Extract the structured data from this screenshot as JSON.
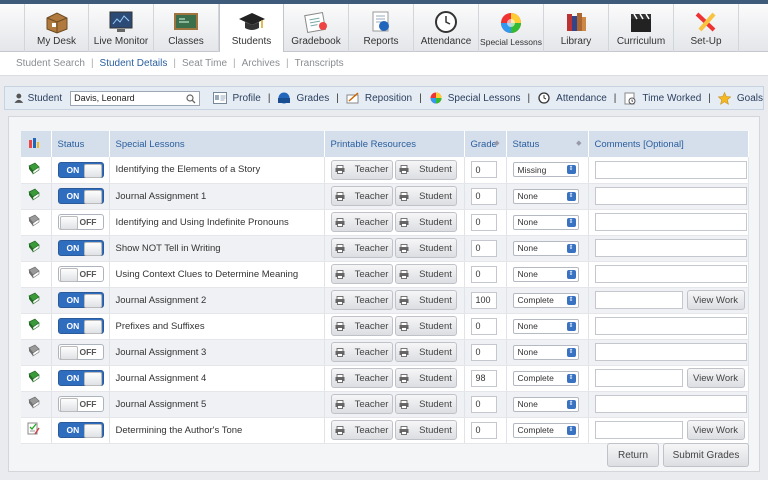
{
  "nav": {
    "items": [
      {
        "label": "My Desk",
        "icon": "box-icon"
      },
      {
        "label": "Live Monitor",
        "icon": "monitor-icon"
      },
      {
        "label": "Classes",
        "icon": "chalkboard-icon"
      },
      {
        "label": "Students",
        "icon": "graduation-cap-icon"
      },
      {
        "label": "Gradebook",
        "icon": "gradebook-icon"
      },
      {
        "label": "Reports",
        "icon": "reports-icon"
      },
      {
        "label": "Attendance",
        "icon": "clock-icon"
      },
      {
        "label": "Special Lessons",
        "icon": "color-wheel-icon"
      },
      {
        "label": "Library",
        "icon": "books-icon"
      },
      {
        "label": "Curriculum",
        "icon": "clapper-icon"
      },
      {
        "label": "Set-Up",
        "icon": "setup-icon"
      }
    ],
    "active": "Students"
  },
  "subnav": {
    "items": [
      "Student Search",
      "Student Details",
      "Seat Time",
      "Archives",
      "Transcripts"
    ],
    "active": "Student Details"
  },
  "studentbar": {
    "label": "Student",
    "student_name": "Davis, Leonard",
    "links": [
      "Profile",
      "Grades",
      "Reposition",
      "Special Lessons",
      "Attendance",
      "Time Worked",
      "Goals"
    ]
  },
  "table": {
    "headers": {
      "status": "Status",
      "lesson": "Special Lessons",
      "resources": "Printable Resources",
      "grade": "Grade",
      "status2": "Status",
      "comments": "Comments [Optional]"
    },
    "teacher_label": "Teacher",
    "student_label": "Student",
    "view_work_label": "View Work",
    "rows": [
      {
        "toggle": "ON",
        "lesson": "Identifying the Elements of a Story",
        "grade": "0",
        "status": "Missing",
        "view_work": false,
        "icon": "green-book-icon"
      },
      {
        "toggle": "ON",
        "lesson": "Journal Assignment 1",
        "grade": "0",
        "status": "None",
        "view_work": false,
        "icon": "green-book-icon"
      },
      {
        "toggle": "OFF",
        "lesson": "Identifying and Using Indefinite Pronouns",
        "grade": "0",
        "status": "None",
        "view_work": false,
        "icon": "grey-book-icon"
      },
      {
        "toggle": "ON",
        "lesson": "Show NOT Tell in Writing",
        "grade": "0",
        "status": "None",
        "view_work": false,
        "icon": "green-book-icon"
      },
      {
        "toggle": "OFF",
        "lesson": "Using Context Clues to Determine Meaning",
        "grade": "0",
        "status": "None",
        "view_work": false,
        "icon": "grey-book-icon"
      },
      {
        "toggle": "ON",
        "lesson": "Journal Assignment 2",
        "grade": "100",
        "status": "Complete",
        "view_work": true,
        "icon": "green-book-icon"
      },
      {
        "toggle": "ON",
        "lesson": "Prefixes and Suffixes",
        "grade": "0",
        "status": "None",
        "view_work": false,
        "icon": "green-book-icon"
      },
      {
        "toggle": "OFF",
        "lesson": "Journal Assignment 3",
        "grade": "0",
        "status": "None",
        "view_work": false,
        "icon": "grey-book-icon"
      },
      {
        "toggle": "ON",
        "lesson": "Journal Assignment 4",
        "grade": "98",
        "status": "Complete",
        "view_work": true,
        "icon": "green-book-icon"
      },
      {
        "toggle": "OFF",
        "lesson": "Journal Assignment 5",
        "grade": "0",
        "status": "None",
        "view_work": false,
        "icon": "grey-book-icon"
      },
      {
        "toggle": "ON",
        "lesson": "Determining the Author's Tone",
        "grade": "0",
        "status": "Complete",
        "view_work": true,
        "icon": "checklist-icon"
      }
    ]
  },
  "actions": {
    "return_label": "Return",
    "submit_label": "Submit Grades"
  }
}
